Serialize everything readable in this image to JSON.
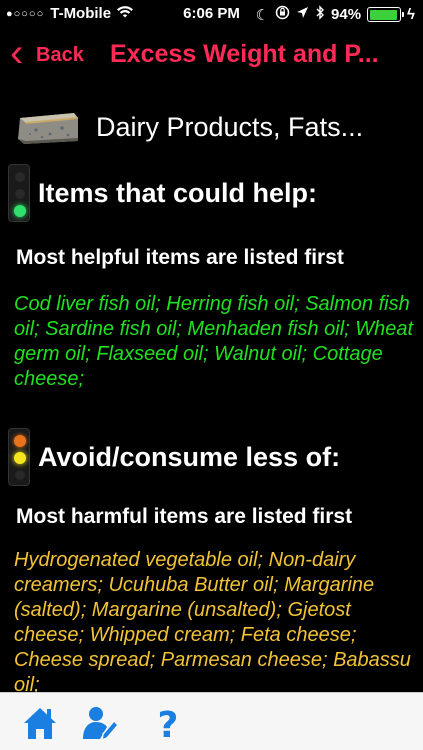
{
  "status": {
    "carrier": "T-Mobile",
    "time": "6:06 PM",
    "battery": "94%",
    "battery_level": 0.94
  },
  "nav": {
    "back_label": "Back",
    "title": "Excess Weight and P..."
  },
  "category": {
    "name": "Dairy Products, Fats..."
  },
  "helpful": {
    "title": "Items that could help:",
    "subtitle": "Most helpful items are listed first",
    "items": "Cod liver fish oil; Herring fish oil; Salmon fish oil; Sardine fish oil; Menhaden fish oil; Wheat germ oil; Flaxseed oil; Walnut oil; Cottage cheese;",
    "color": "#20e020"
  },
  "harmful": {
    "title": "Avoid/consume less of:",
    "subtitle": "Most harmful items are listed first",
    "items": "Hydrogenated vegetable oil; Non-dairy creamers; Ucuhuba Butter oil; Margarine (salted); Margarine (unsalted); Gjetost cheese; Whipped cream; Feta cheese; Cheese spread; Parmesan cheese; Babassu oil;",
    "color": "#f2c337"
  },
  "accent_color": "#ff2a55",
  "tabs": [
    {
      "icon": "home-icon"
    },
    {
      "icon": "user-edit-icon"
    },
    {
      "icon": "help-icon"
    }
  ]
}
